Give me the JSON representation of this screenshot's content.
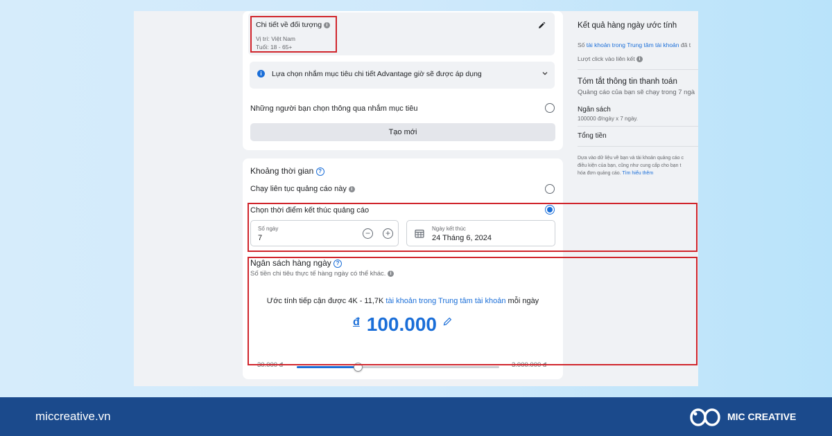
{
  "audience": {
    "title": "Chi tiết về đối tượng",
    "location": "Vị trí: Việt Nam",
    "age": "Tuổi: 18 - 65+"
  },
  "advantage_notice": "Lựa chọn nhắm mục tiêu chi tiết Advantage giờ sẽ được áp dụng",
  "targeting_option": "Những người bạn chọn thông qua nhắm mục tiêu",
  "create_new_label": "Tạo mới",
  "schedule": {
    "title": "Khoảng thời gian",
    "run_continuously": "Chạy liên tục quảng cáo này",
    "choose_end": "Chọn thời điểm kết thúc quảng cáo",
    "days_label": "Số ngày",
    "days_value": "7",
    "end_date_label": "Ngày kết thúc",
    "end_date_value": "24 Tháng 6, 2024"
  },
  "budget": {
    "title": "Ngân sách hàng ngày",
    "subtitle": "Số tiền chi tiêu thực tế hàng ngày có thể khác.",
    "reach_prefix": "Ước tính tiếp cận được 4K - 11,7K",
    "reach_link": "tài khoản trong Trung tâm tài khoản",
    "reach_suffix": "mỗi ngày",
    "currency": "đ",
    "amount": "100.000",
    "min_label": "30.000 đ",
    "max_label": "3.000.000 đ",
    "slider_fraction": 0.3
  },
  "right_panel": {
    "daily_results_title": "Kết quả hàng ngày ước tính",
    "accounts_prefix": "Số",
    "accounts_link": "tài khoản trong Trung tâm tài khoản",
    "accounts_suffix": "đã t",
    "link_clicks": "Lượt click vào liên kết",
    "payment_title": "Tóm tắt thông tin thanh toán",
    "payment_sub": "Quảng cáo của bạn sẽ chạy trong 7 ngà",
    "budget_label": "Ngân sách",
    "budget_detail": "100000 đ/ngày x 7 ngày.",
    "total_label": "Tổng tiền",
    "disclaimer_1": "Dựa vào dữ liệu về bạn và tài khoản quảng cáo c",
    "disclaimer_2": "điều kiện của bạn, cũng như cung cấp cho bạn t",
    "disclaimer_3": "hóa đơn quảng cáo.",
    "learn_more": "Tìm hiểu thêm"
  },
  "footer": {
    "site": "miccreative.vn",
    "brand": "MIC CREATIVE"
  },
  "colors": {
    "accent": "#1a6ed8",
    "highlight": "#d0242b",
    "footer_bg": "#1b4a8c"
  }
}
